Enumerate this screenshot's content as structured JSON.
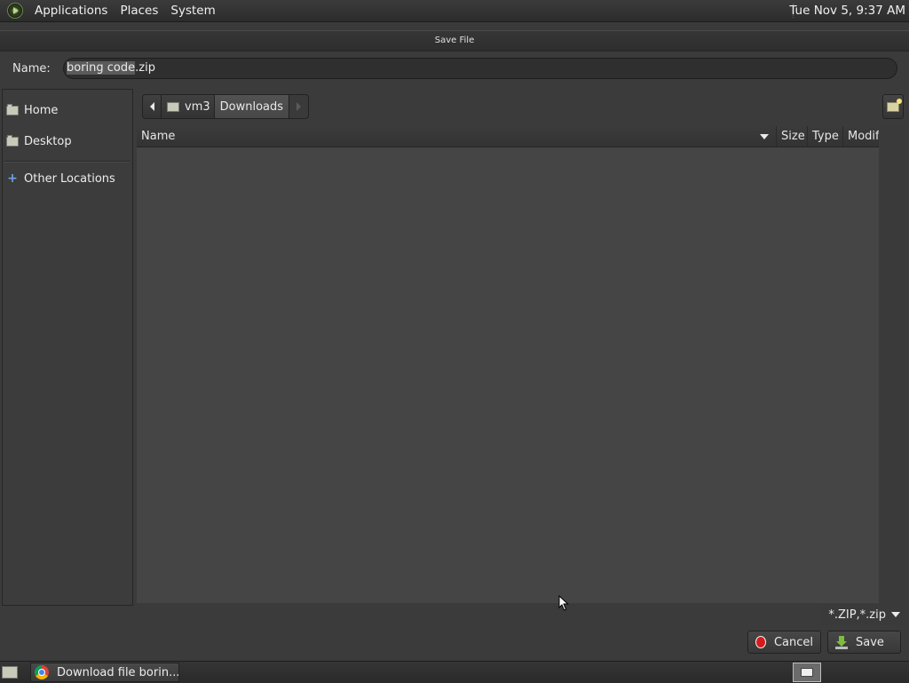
{
  "top_panel": {
    "menus": [
      "Applications",
      "Places",
      "System"
    ],
    "clock": "Tue Nov  5,  9:37 AM"
  },
  "dialog": {
    "title": "Save File",
    "name_label": "Name:",
    "name_value_selected": "boring code",
    "name_value_rest": ".zip",
    "sidebar": {
      "home": "Home",
      "desktop": "Desktop",
      "other_locations": "Other Locations"
    },
    "pathbar": {
      "parent": "vm3",
      "current": "Downloads"
    },
    "columns": {
      "name": "Name",
      "size": "Size",
      "type": "Type",
      "modified": "Modif"
    },
    "filter": "*.ZIP,*.zip",
    "cancel_label": "Cancel",
    "save_label": "Save"
  },
  "taskbar": {
    "task_label": "Download file borin..."
  }
}
